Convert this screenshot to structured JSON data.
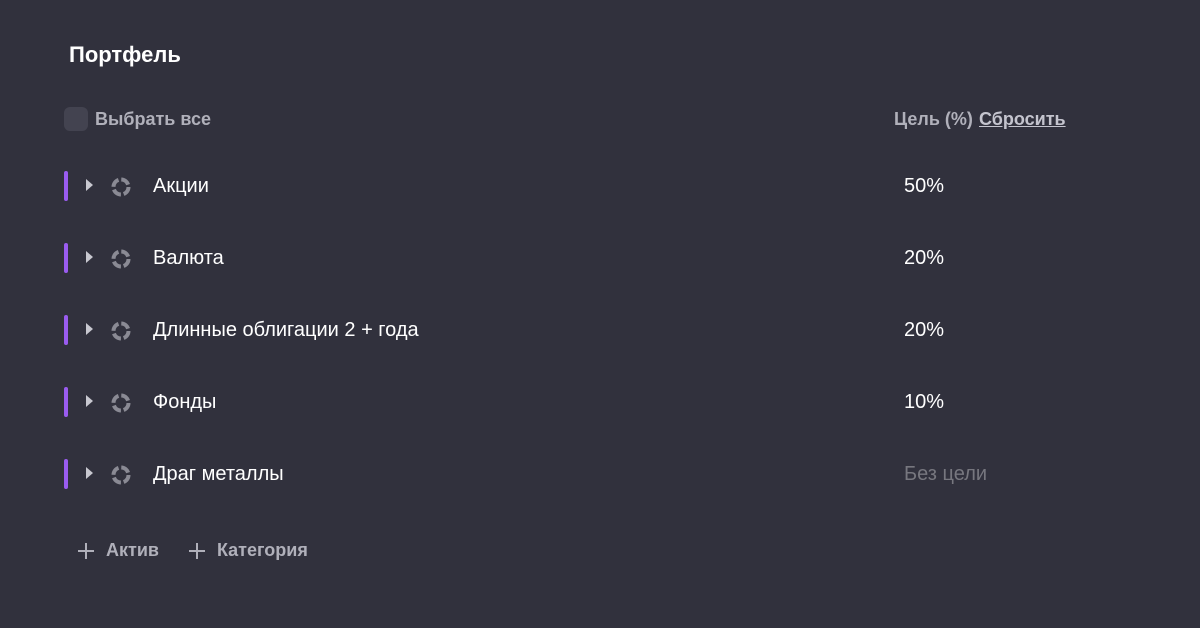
{
  "portfolio": {
    "title": "Портфель",
    "select_all_label": "Выбрать все",
    "goal_header": "Цель (%)",
    "reset_label": "Сбросить",
    "accent_color": "#9a5cf0",
    "categories": [
      {
        "name": "Акции",
        "goal": "50%",
        "icon": "donut-chart-icon"
      },
      {
        "name": "Валюта",
        "goal": "20%",
        "icon": "donut-chart-icon"
      },
      {
        "name": "Длинные облигации 2 + года",
        "goal": "20%",
        "icon": "donut-chart-icon"
      },
      {
        "name": "Фонды",
        "goal": "10%",
        "icon": "donut-chart-icon"
      },
      {
        "name": "Драг металлы",
        "goal": "Без цели",
        "icon": "donut-chart-icon"
      }
    ],
    "footer": {
      "add_asset_label": "Актив",
      "add_category_label": "Категория"
    }
  }
}
